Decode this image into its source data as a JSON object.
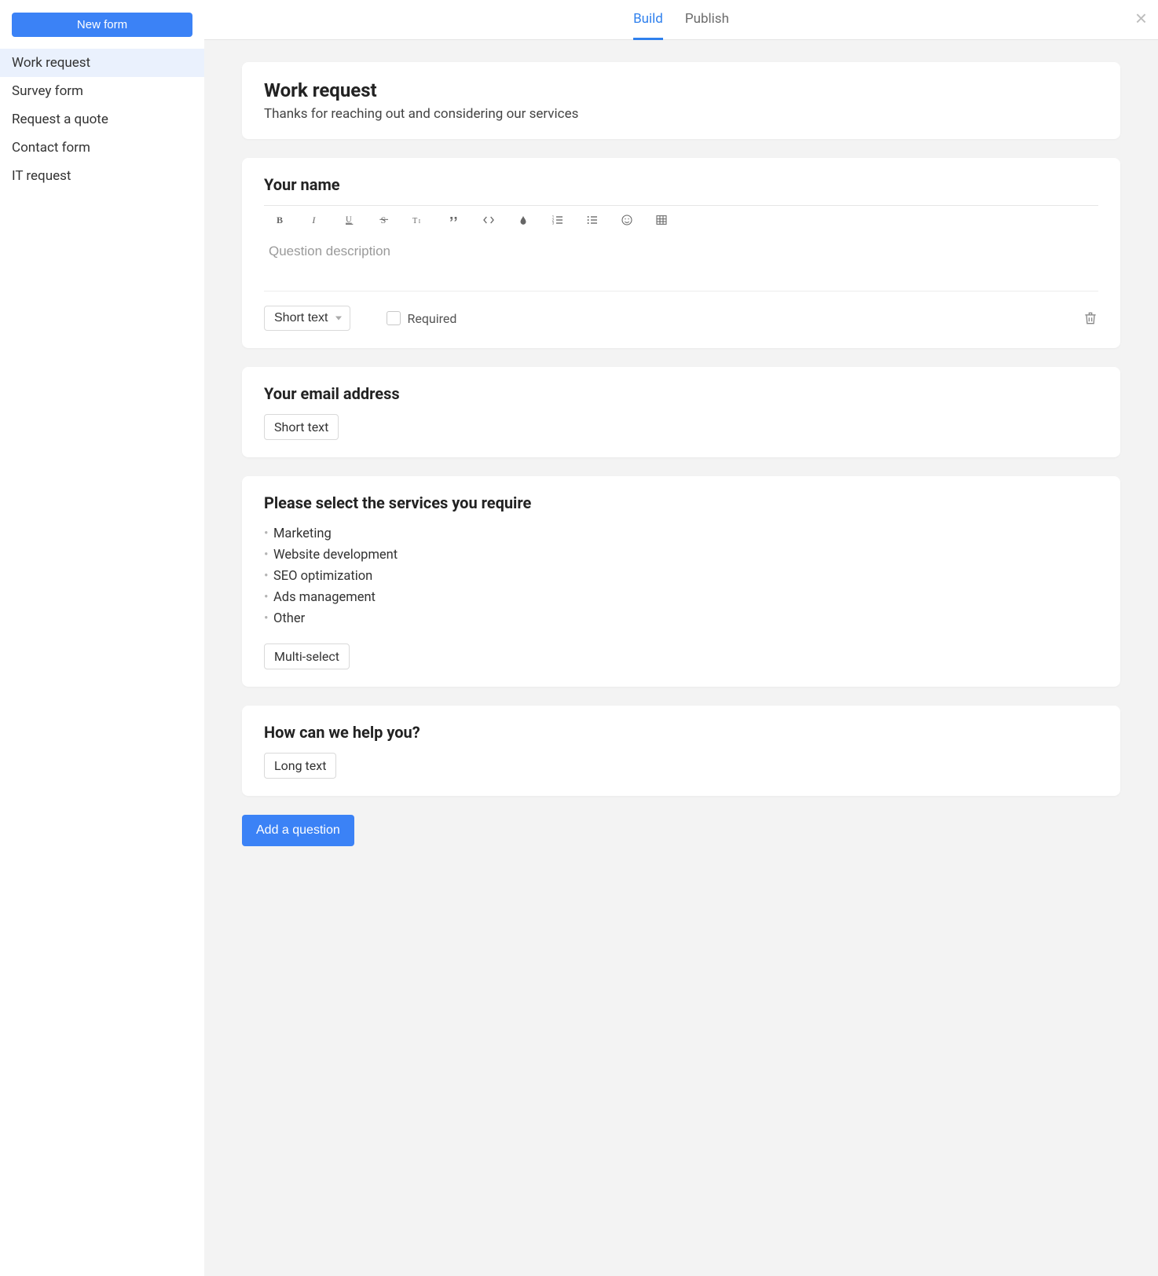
{
  "sidebar": {
    "new_form_label": "New form",
    "forms": [
      {
        "name": "Work request",
        "active": true
      },
      {
        "name": "Survey form",
        "active": false
      },
      {
        "name": "Request a quote",
        "active": false
      },
      {
        "name": "Contact form",
        "active": false
      },
      {
        "name": "IT request",
        "active": false
      }
    ]
  },
  "tabs": [
    {
      "label": "Build",
      "active": true
    },
    {
      "label": "Publish",
      "active": false
    }
  ],
  "header_card": {
    "title": "Work request",
    "subtitle": "Thanks for reaching out and considering our services"
  },
  "questions": [
    {
      "title": "Your name",
      "type_label": "Short text",
      "editing": true,
      "desc_placeholder": "Question description",
      "required_label": "Required"
    },
    {
      "title": "Your email address",
      "type_label": "Short text"
    },
    {
      "title": "Please select the services you require",
      "type_label": "Multi-select",
      "options": [
        "Marketing",
        "Website development",
        "SEO optimization",
        "Ads management",
        "Other"
      ]
    },
    {
      "title": "How can we help you?",
      "type_label": "Long text"
    }
  ],
  "add_question_label": "Add a question"
}
